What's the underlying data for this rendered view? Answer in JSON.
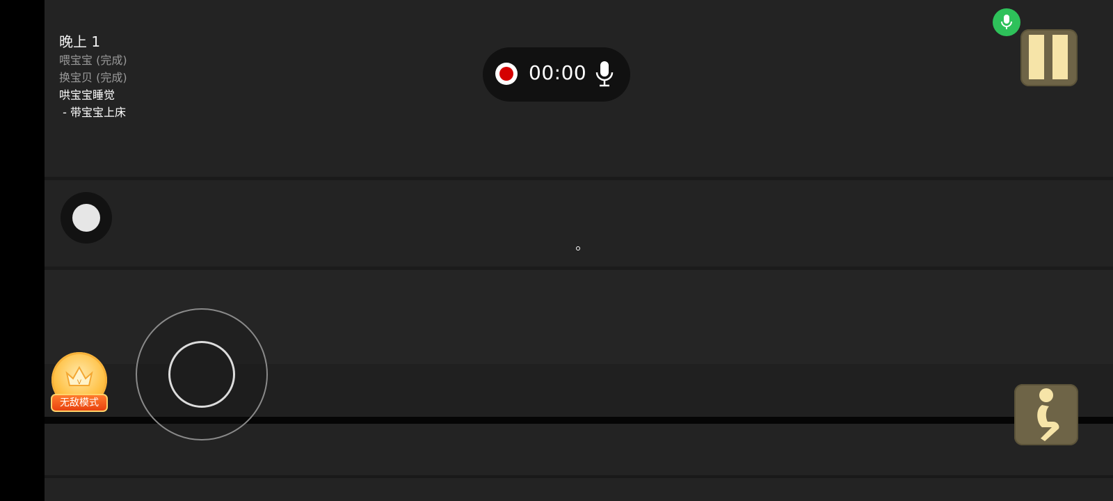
{
  "objectives": {
    "title": "晚上 1",
    "items": [
      {
        "text": "喂宝宝 (完成)",
        "status": "done"
      },
      {
        "text": "换宝贝 (完成)",
        "status": "done"
      },
      {
        "text": "哄宝宝睡觉",
        "status": "active"
      },
      {
        "text": " - 带宝宝上床",
        "status": "active"
      }
    ]
  },
  "recorder": {
    "time": "00:00",
    "record_icon": "record-icon",
    "mic_icon": "microphone-icon"
  },
  "controls": {
    "voice_chat_icon": "microphone-icon",
    "pause_icon": "pause-icon",
    "action_icon": "circle-button",
    "crouch_icon": "crouch-icon",
    "joystick": "virtual-joystick"
  },
  "badge": {
    "label": "无敌模式",
    "crown_letter": "V"
  },
  "colors": {
    "background": "#232323",
    "voice_active": "#2ec15a",
    "button_bg": "#6e6447",
    "button_glyph": "#f6e4a8",
    "record_red": "#d40000",
    "badge_orange": "#e9420f"
  }
}
